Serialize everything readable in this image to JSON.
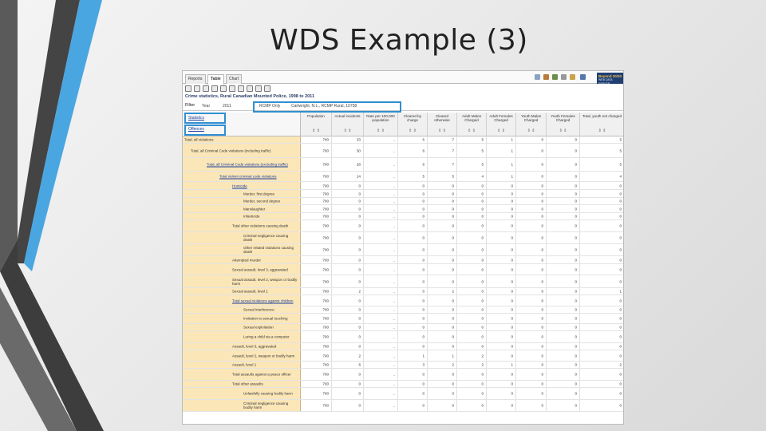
{
  "slide": {
    "title": "WDS Example (3)"
  },
  "app": {
    "tabs": [
      {
        "label": "Reports",
        "active": false
      },
      {
        "label": "Table",
        "active": true
      },
      {
        "label": "Chart",
        "active": false
      }
    ],
    "brand": {
      "name": "Beyond 20/20",
      "sub": "WEB DATA SERVER"
    },
    "table_title": "Crime statistics, Rural Canadian Mounted Police, 1998 to 2011",
    "filter": {
      "label": "Filter",
      "year": "Year",
      "year_value": "2011",
      "scope": "RCMP Only",
      "location": "Cartwright, N.L., RCMP Rural, 10758"
    },
    "dimensions": {
      "statistics": "Statistics",
      "offences": "Offences"
    },
    "columns": [
      "Population",
      "Actual incidents",
      "Rate per 100,000 population",
      "Cleared by charge",
      "Cleared otherwise",
      "Adult Males Charged",
      "Adult Females Charged",
      "Youth Males Charged",
      "Youth Females Charged",
      "Total, youth not charged"
    ],
    "sort_glyph": "⇕ ⇕",
    "rows": [
      {
        "label": "Total, all violations",
        "values": [
          "700",
          "33",
          "..",
          "6",
          "7",
          "5",
          "1",
          "0",
          "0",
          "5"
        ]
      },
      {
        "label": "Total, all Criminal Code violations (including traffic)",
        "values": [
          "700",
          "30",
          "..",
          "6",
          "7",
          "5",
          "1",
          "0",
          "0",
          "5"
        ]
      },
      {
        "label": "Total, all Criminal Code violations (excluding traffic)",
        "values": [
          "700",
          "28",
          "..",
          "6",
          "7",
          "5",
          "1",
          "0",
          "0",
          "5"
        ]
      },
      {
        "label": "Total violent criminal code violations",
        "values": [
          "700",
          "14",
          "..",
          "5",
          "5",
          "4",
          "1",
          "0",
          "0",
          "4"
        ]
      },
      {
        "label": "Homicide",
        "values": [
          "700",
          "0",
          "..",
          "0",
          "0",
          "0",
          "0",
          "0",
          "0",
          "0"
        ]
      },
      {
        "label": "Murder, first degree",
        "values": [
          "700",
          "0",
          "..",
          "0",
          "0",
          "0",
          "0",
          "0",
          "0",
          "0"
        ]
      },
      {
        "label": "Murder, second degree",
        "values": [
          "700",
          "0",
          "..",
          "0",
          "0",
          "0",
          "0",
          "0",
          "0",
          "0"
        ]
      },
      {
        "label": "Manslaughter",
        "values": [
          "700",
          "0",
          "..",
          "0",
          "0",
          "0",
          "0",
          "0",
          "0",
          "0"
        ]
      },
      {
        "label": "Infanticide",
        "values": [
          "700",
          "0",
          "..",
          "0",
          "0",
          "0",
          "0",
          "0",
          "0",
          "0"
        ]
      },
      {
        "label": "Total other violations causing death",
        "values": [
          "700",
          "0",
          "..",
          "0",
          "0",
          "0",
          "0",
          "0",
          "0",
          "0"
        ]
      },
      {
        "label": "Criminal negligence causing death",
        "values": [
          "700",
          "0",
          "..",
          "0",
          "0",
          "0",
          "0",
          "0",
          "0",
          "0"
        ]
      },
      {
        "label": "Other related violations causing death",
        "values": [
          "700",
          "0",
          "..",
          "0",
          "0",
          "0",
          "0",
          "0",
          "0",
          "0"
        ]
      },
      {
        "label": "Attempted murder",
        "values": [
          "700",
          "0",
          "..",
          "0",
          "0",
          "0",
          "0",
          "0",
          "0",
          "0"
        ]
      },
      {
        "label": "Sexual assault, level 3, aggravated",
        "values": [
          "700",
          "0",
          "..",
          "0",
          "0",
          "0",
          "0",
          "0",
          "0",
          "0"
        ]
      },
      {
        "label": "Sexual assault, level 2, weapon or bodily harm",
        "values": [
          "700",
          "0",
          "..",
          "0",
          "0",
          "0",
          "0",
          "0",
          "0",
          "0"
        ]
      },
      {
        "label": "Sexual assault, level 1",
        "values": [
          "700",
          "2",
          "..",
          "0",
          "2",
          "0",
          "0",
          "0",
          "0",
          "1"
        ]
      },
      {
        "label": "Total sexual violations against children",
        "values": [
          "700",
          "0",
          "..",
          "0",
          "0",
          "0",
          "0",
          "0",
          "0",
          "0"
        ]
      },
      {
        "label": "Sexual interference",
        "values": [
          "700",
          "0",
          "..",
          "0",
          "0",
          "0",
          "0",
          "0",
          "0",
          "0"
        ]
      },
      {
        "label": "Invitation to sexual touching",
        "values": [
          "700",
          "0",
          "..",
          "0",
          "0",
          "0",
          "0",
          "0",
          "0",
          "0"
        ]
      },
      {
        "label": "Sexual exploitation",
        "values": [
          "700",
          "0",
          "..",
          "0",
          "0",
          "0",
          "0",
          "0",
          "0",
          "0"
        ]
      },
      {
        "label": "Luring a child via a computer",
        "values": [
          "700",
          "0",
          "..",
          "0",
          "0",
          "0",
          "0",
          "0",
          "0",
          "0"
        ]
      },
      {
        "label": "Assault, level 3, aggravated",
        "values": [
          "700",
          "0",
          "..",
          "0",
          "0",
          "0",
          "0",
          "0",
          "0",
          "0"
        ]
      },
      {
        "label": "Assault, level 2, weapon or bodily harm",
        "values": [
          "700",
          "2",
          "..",
          "1",
          "1",
          "2",
          "0",
          "0",
          "0",
          "0"
        ]
      },
      {
        "label": "Assault, level 1",
        "values": [
          "700",
          "6",
          "..",
          "3",
          "2",
          "2",
          "1",
          "0",
          "0",
          "2"
        ]
      },
      {
        "label": "Total assaults against a peace officer",
        "values": [
          "700",
          "0",
          "..",
          "0",
          "0",
          "0",
          "0",
          "0",
          "0",
          "0"
        ]
      },
      {
        "label": "Total other assaults",
        "values": [
          "700",
          "0",
          "..",
          "0",
          "0",
          "0",
          "0",
          "0",
          "0",
          "0"
        ]
      },
      {
        "label": "Unlawfully causing bodily harm",
        "values": [
          "700",
          "0",
          "..",
          "0",
          "0",
          "0",
          "0",
          "0",
          "0",
          "0"
        ]
      },
      {
        "label": "Criminal negligence causing bodily harm",
        "values": [
          "700",
          "0",
          "..",
          "0",
          "0",
          "0",
          "0",
          "0",
          "0",
          "0"
        ]
      }
    ],
    "highlight_color": "#2f8fd0"
  }
}
